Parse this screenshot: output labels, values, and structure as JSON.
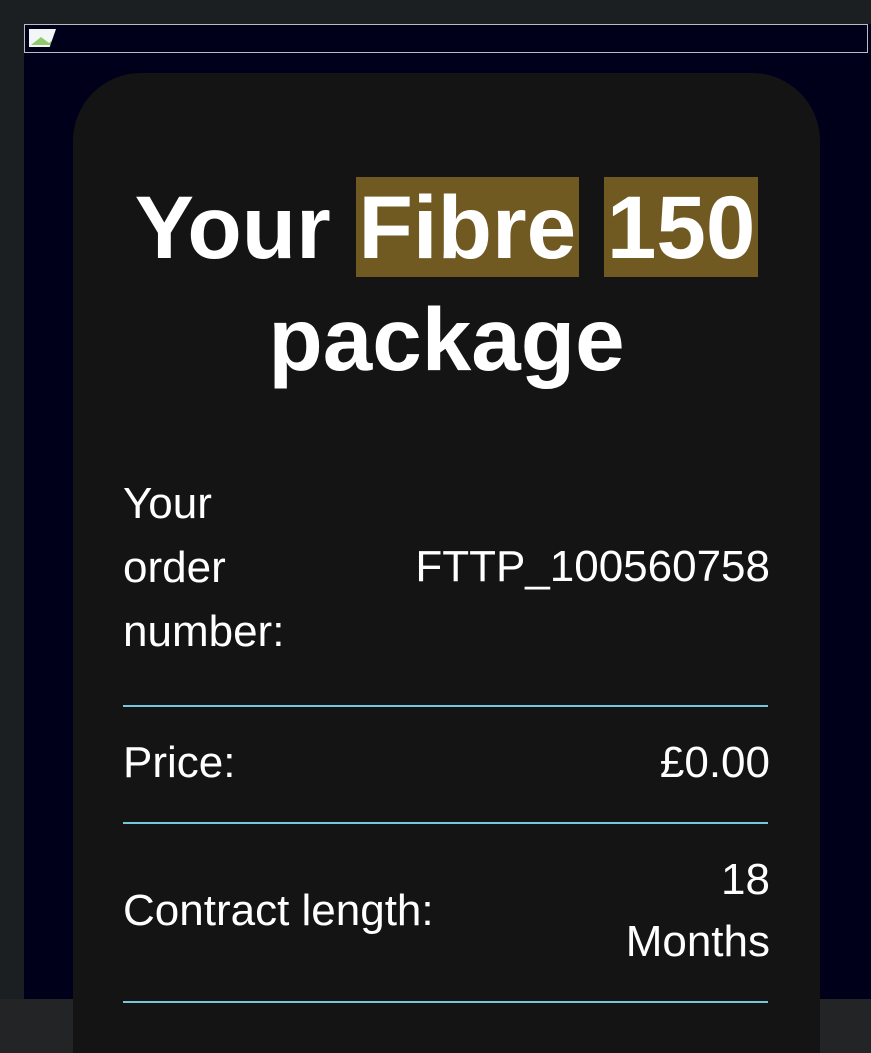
{
  "headline": {
    "prefix": "Your",
    "highlight_1": "Fibre",
    "highlight_2": "150",
    "suffix": "package"
  },
  "order_number": {
    "label_lines": [
      "Your",
      "order",
      "number:"
    ],
    "value": "FTTP_100560758"
  },
  "price": {
    "label": "Price:",
    "value": "£0.00"
  },
  "contract_length": {
    "label": "Contract length:",
    "value_lines": [
      "18",
      "Months"
    ]
  },
  "colors": {
    "card_background": "#141414",
    "highlight": "#705a22",
    "divider": "#79c6d9",
    "frame_background": "#00001a"
  },
  "icons": {
    "broken_image": "broken-image-icon"
  }
}
